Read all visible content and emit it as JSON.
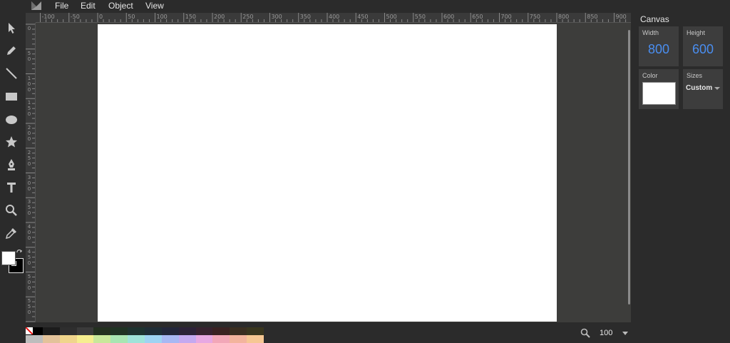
{
  "menu": {
    "logo_icon": "app-logo-icon",
    "items": [
      {
        "label": "File"
      },
      {
        "label": "Edit"
      },
      {
        "label": "Object"
      },
      {
        "label": "View"
      }
    ]
  },
  "toolbar": {
    "tools": [
      {
        "name": "select-tool",
        "icon": "cursor-arrow-icon"
      },
      {
        "name": "pencil-tool",
        "icon": "pencil-icon"
      },
      {
        "name": "line-tool",
        "icon": "line-icon"
      },
      {
        "name": "rectangle-tool",
        "icon": "rectangle-icon"
      },
      {
        "name": "ellipse-tool",
        "icon": "ellipse-icon"
      },
      {
        "name": "star-tool",
        "icon": "star-icon"
      },
      {
        "name": "pen-tool",
        "icon": "pen-nib-icon"
      },
      {
        "name": "text-tool",
        "icon": "text-icon"
      },
      {
        "name": "zoom-tool",
        "icon": "magnifier-icon"
      },
      {
        "name": "eyedropper-tool",
        "icon": "eyedropper-icon"
      }
    ],
    "fill_color": "#ffffff",
    "stroke_color": "#000000"
  },
  "ruler": {
    "top_labels": [
      "-100",
      "-50",
      "0",
      "50",
      "100",
      "150",
      "200",
      "250",
      "300",
      "350",
      "400",
      "450",
      "500",
      "550",
      "600",
      "650",
      "700",
      "750",
      "800",
      "850",
      "900"
    ],
    "left_labels": [
      "0",
      "50",
      "100",
      "150",
      "200",
      "250",
      "300",
      "350",
      "400",
      "450",
      "500",
      "550"
    ]
  },
  "canvas": {
    "background": "#ffffff"
  },
  "bottom": {
    "zoom_value": "100"
  },
  "panel": {
    "title": "Canvas",
    "width_label": "Width",
    "width_value": "800",
    "height_label": "Height",
    "height_value": "600",
    "color_label": "Color",
    "color_value": "#ffffff",
    "sizes_label": "Sizes",
    "sizes_value": "Custom"
  },
  "colors": {
    "accent": "#4a8ef0",
    "background": "#2b2b2b",
    "workarea": "#3d3d3b"
  }
}
